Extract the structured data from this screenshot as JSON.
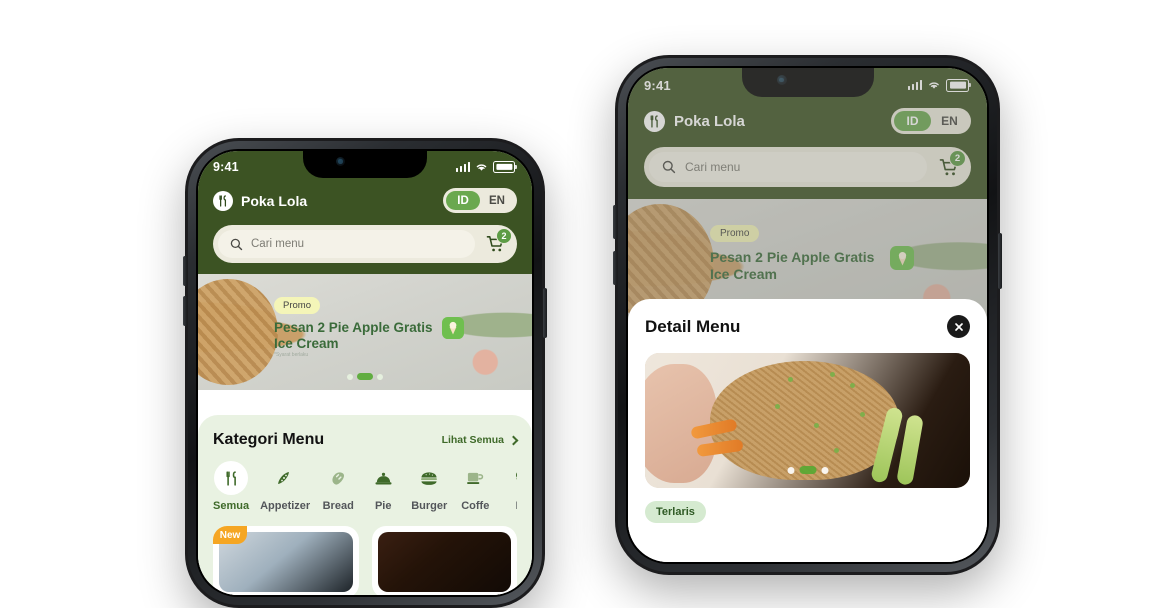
{
  "left_phone": {
    "status_bar": {
      "time": "9:41",
      "signal": "signal-bars-icon",
      "wifi": "wifi-icon",
      "battery": "battery-full-icon"
    },
    "app_bar": {
      "logo": "fork-knife-logo-icon",
      "brand_name": "Poka Lola",
      "language_toggle": {
        "active": "ID",
        "options": [
          "ID",
          "EN"
        ]
      }
    },
    "search": {
      "icon": "search-icon",
      "placeholder": "Cari menu",
      "value": ""
    },
    "cart": {
      "icon": "shopping-cart-icon",
      "badge": "2"
    },
    "banner": {
      "badge": "Promo",
      "title": "Pesan 2 Pie Apple Gratis Ice Cream",
      "subtitle": "*Syarat berlaku",
      "side_icon": "ice-cream-icon",
      "dots": {
        "count": 3,
        "active_index": 1
      }
    },
    "category_section": {
      "title": "Kategori Menu",
      "see_all": "Lihat Semua",
      "chevron": "chevron-right-icon",
      "items": [
        {
          "label": "Semua",
          "icon": "fork-knife-icon",
          "active": true
        },
        {
          "label": "Appetizer",
          "icon": "watermelon-slice-icon",
          "active": false
        },
        {
          "label": "Bread",
          "icon": "bread-loaf-icon",
          "active": false
        },
        {
          "label": "Pie",
          "icon": "pie-dome-icon",
          "active": false
        },
        {
          "label": "Burger",
          "icon": "burger-icon",
          "active": false
        },
        {
          "label": "Coffe",
          "icon": "coffee-cup-icon",
          "active": false
        },
        {
          "label": "Ic",
          "icon": "ice-cream-cone-icon",
          "active": false
        }
      ]
    },
    "product_cards": [
      {
        "badge": "New",
        "thumb": "product-thumbnail"
      },
      {
        "badge": "",
        "thumb": "product-thumbnail"
      }
    ]
  },
  "right_phone": {
    "status_bar": {
      "time": "9:41",
      "signal": "signal-bars-icon",
      "wifi": "wifi-icon",
      "battery": "battery-full-icon"
    },
    "app_bar": {
      "logo": "fork-knife-logo-icon",
      "brand_name": "Poka Lola",
      "language_toggle": {
        "active": "ID",
        "options": [
          "ID",
          "EN"
        ]
      }
    },
    "search": {
      "icon": "search-icon",
      "placeholder": "Cari menu",
      "value": ""
    },
    "cart": {
      "icon": "shopping-cart-icon",
      "badge": "2"
    },
    "banner": {
      "badge": "Promo",
      "title": "Pesan 2 Pie Apple Gratis Ice Cream",
      "side_icon": "ice-cream-icon"
    },
    "modal": {
      "title": "Detail Menu",
      "close_icon": "close-x-icon",
      "gallery": {
        "image": "fried-rice-photo",
        "dots": {
          "count": 3,
          "active_index": 1
        }
      },
      "tag": "Terlaris"
    }
  },
  "colors": {
    "app_green": "#3c5323",
    "accent_green": "#6aa84f",
    "badge_green": "#5d9c45",
    "cream": "#eceadd",
    "sheet_bg": "#e9f2e2",
    "promo_yellow": "#f4f5b8",
    "new_orange": "#f5a623",
    "title_green": "#3a6b3a",
    "terlaris_bg": "#d5ead0"
  }
}
